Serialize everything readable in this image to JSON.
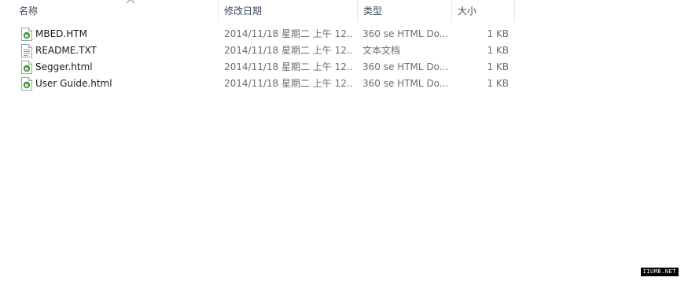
{
  "columns": {
    "name": "名称",
    "date": "修改日期",
    "type": "类型",
    "size": "大小"
  },
  "sort": {
    "column": "name",
    "direction": "ascending",
    "icon": "chevron-up-icon"
  },
  "files": [
    {
      "name": "MBED.HTM",
      "date": "2014/11/18 星期二 上午 12...",
      "type": "360 se HTML Do...",
      "size": "1 KB",
      "icon": "html-document-icon"
    },
    {
      "name": "README.TXT",
      "date": "2014/11/18 星期二 上午 12...",
      "type": "文本文档",
      "size": "1 KB",
      "icon": "text-document-icon"
    },
    {
      "name": "Segger.html",
      "date": "2014/11/18 星期二 上午 12...",
      "type": "360 se HTML Do...",
      "size": "1 KB",
      "icon": "html-document-icon"
    },
    {
      "name": "User Guide.html",
      "date": "2014/11/18 星期二 上午 12...",
      "type": "360 se HTML Do...",
      "size": "1 KB",
      "icon": "html-document-icon"
    }
  ],
  "watermark": "IIUMB.NET",
  "colors": {
    "header_text": "#3d4a5c",
    "name_text": "#1a1a1a",
    "detail_text": "#6d6d6d",
    "html_icon_accent": "#3a9b2e",
    "column_separator": "#e5e5e5"
  }
}
